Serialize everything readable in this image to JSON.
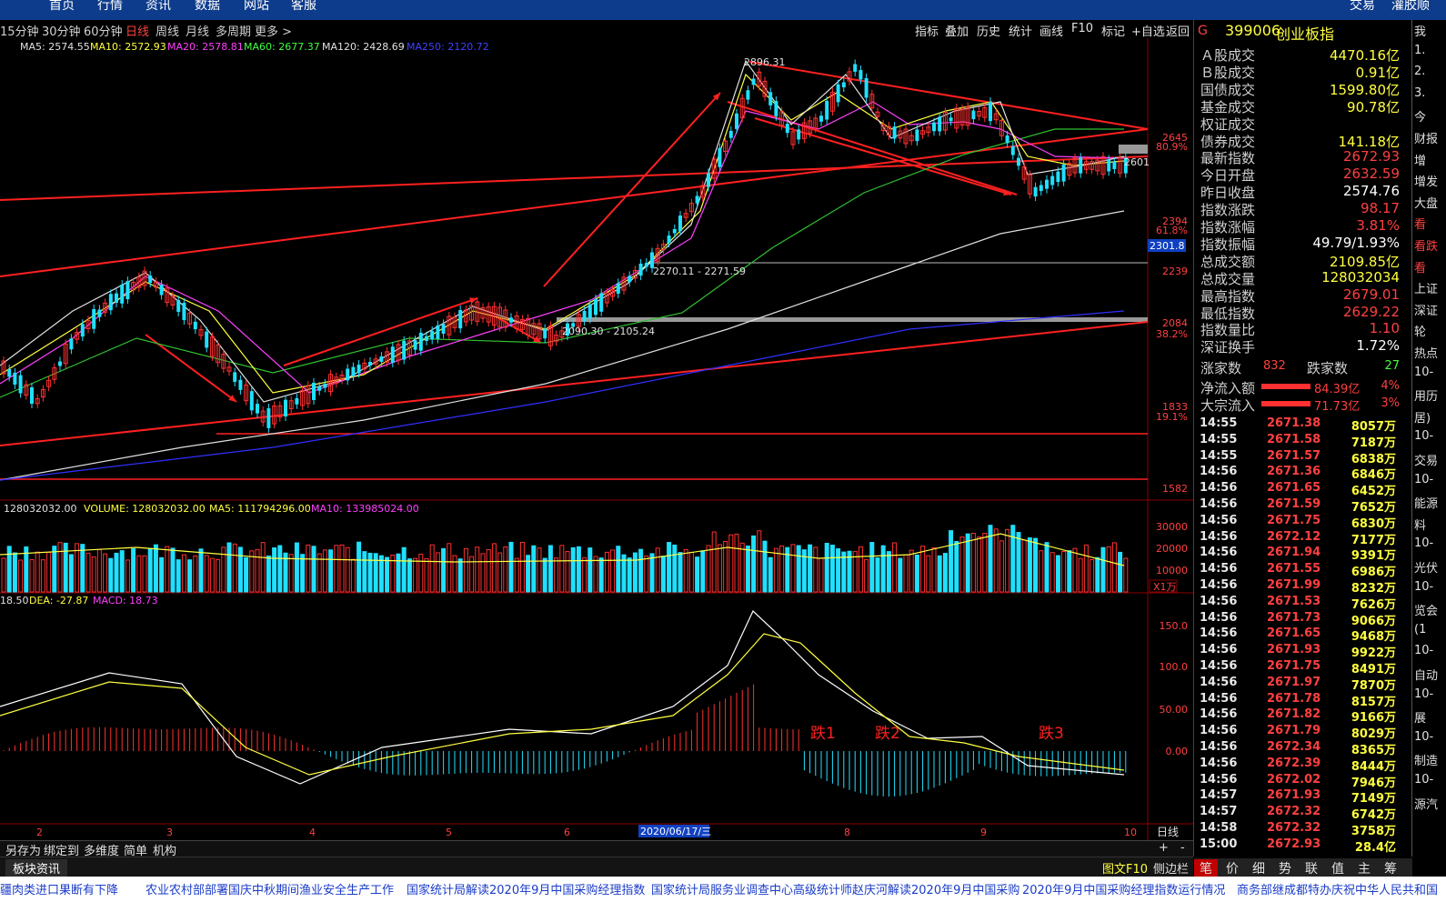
{
  "topbar": {
    "items": [
      "首页",
      "行情",
      "资讯",
      "数据",
      "网站",
      "客服"
    ],
    "right": [
      "交易",
      "灌胶顺"
    ]
  },
  "periods": {
    "items": [
      "15分钟",
      "30分钟",
      "60分钟",
      "日线",
      "周线",
      "月线",
      "多周期",
      "更多 >"
    ],
    "active": "日线"
  },
  "tools": {
    "items": [
      "指标",
      "叠加",
      "历史",
      "统计",
      "画线",
      "F10",
      "标记",
      "+自选",
      "返回"
    ]
  },
  "ma_legend": {
    "ma5": "MA5: 2574.55",
    "ma10": "MA10: 2572.93",
    "ma20": "MA20: 2578.81",
    "ma60": "MA60: 2677.37",
    "ma120": "MA120: 2428.69",
    "ma250": "MA250: 2120.72"
  },
  "chart_labels": {
    "peak": "2896.31",
    "range1": "2270.11 - 2271.59",
    "range2": "2090.30 - 2105.24",
    "current": "2601",
    "cursor_price": "2301.8"
  },
  "y_axis": {
    "price": [
      "2645",
      "2394",
      "2239",
      "2084",
      "1833",
      "1582"
    ],
    "pct": [
      "80.9%",
      "61.8%",
      "38.2%",
      "19.1%"
    ],
    "volume": [
      "30000",
      "20000",
      "10000"
    ],
    "vol_unit": "X1万",
    "macd": [
      "150.0",
      "100.0",
      "50.00",
      "0.00"
    ]
  },
  "volume_legend": {
    "vol": "128032032.00",
    "volume": "VOLUME: 128032032.00",
    "ma5": "MA5: 111794296.00",
    "ma10": "MA10: 133985024.00"
  },
  "macd_legend": {
    "diff": "18.50",
    "dea": "DEA: -27.87",
    "macd": "MACD: 18.73"
  },
  "annotations": [
    "跌1",
    "跌2",
    "跌3"
  ],
  "x_axis": {
    "labels": [
      "2",
      "3",
      "4",
      "5",
      "6",
      "8",
      "9",
      "10"
    ],
    "cursor_date": "2020/06/17/三",
    "period": "日线"
  },
  "bottom": {
    "buttons": [
      "另存为",
      "绑定到",
      "多维度",
      "简单",
      "机构"
    ],
    "plus": "+",
    "minus": "-"
  },
  "infobar": {
    "left": "板块资讯",
    "f10": "图文F10",
    "side": "侧边栏"
  },
  "panel": {
    "code": "399006",
    "name": "创业板指",
    "g": "G",
    "rows": [
      {
        "l": "Ａ股成交",
        "v": "4470.16亿",
        "c": "#ffff40"
      },
      {
        "l": "Ｂ股成交",
        "v": "0.91亿",
        "c": "#ffff40"
      },
      {
        "l": "国债成交",
        "v": "1599.80亿",
        "c": "#ffff40"
      },
      {
        "l": "基金成交",
        "v": "90.78亿",
        "c": "#ffff40"
      },
      {
        "l": "权证成交",
        "v": "",
        "c": "#ffff40"
      },
      {
        "l": "债券成交",
        "v": "141.18亿",
        "c": "#ffff40"
      },
      {
        "l": "最新指数",
        "v": "2672.93",
        "c": "#ff4040"
      },
      {
        "l": "今日开盘",
        "v": "2632.59",
        "c": "#ff4040"
      },
      {
        "l": "昨日收盘",
        "v": "2574.76",
        "c": "#ffffff"
      },
      {
        "l": "指数涨跌",
        "v": "98.17",
        "c": "#ff4040"
      },
      {
        "l": "指数涨幅",
        "v": "3.81%",
        "c": "#ff4040"
      },
      {
        "l": "指数振幅",
        "v": "49.79/1.93%",
        "c": "#ffffff"
      },
      {
        "l": "总成交额",
        "v": "2109.85亿",
        "c": "#ffff40"
      },
      {
        "l": "总成交量",
        "v": "128032034",
        "c": "#ffff40"
      },
      {
        "l": "最高指数",
        "v": "2679.01",
        "c": "#ff4040"
      },
      {
        "l": "最低指数",
        "v": "2629.22",
        "c": "#ff4040"
      },
      {
        "l": "指数量比",
        "v": "1.10",
        "c": "#ff4040"
      },
      {
        "l": "深证换手",
        "v": "1.72%",
        "c": "#ffffff"
      }
    ],
    "updown": {
      "up_label": "涨家数",
      "up": "832",
      "down_label": "跌家数",
      "down": "27"
    },
    "flows": [
      {
        "l": "净流入额",
        "v": "84.39亿",
        "p": "4%"
      },
      {
        "l": "大宗流入",
        "v": "71.73亿",
        "p": "3%"
      }
    ],
    "ticks": [
      [
        "14:55",
        "2671.38",
        "8057万"
      ],
      [
        "14:55",
        "2671.58",
        "7187万"
      ],
      [
        "14:55",
        "2671.57",
        "6838万"
      ],
      [
        "14:56",
        "2671.36",
        "6846万"
      ],
      [
        "14:56",
        "2671.65",
        "6452万"
      ],
      [
        "14:56",
        "2671.59",
        "7652万"
      ],
      [
        "14:56",
        "2671.75",
        "6830万"
      ],
      [
        "14:56",
        "2672.12",
        "7177万"
      ],
      [
        "14:56",
        "2671.94",
        "9391万"
      ],
      [
        "14:56",
        "2671.55",
        "6986万"
      ],
      [
        "14:56",
        "2671.99",
        "8232万"
      ],
      [
        "14:56",
        "2671.53",
        "7626万"
      ],
      [
        "14:56",
        "2671.73",
        "9066万"
      ],
      [
        "14:56",
        "2671.65",
        "9468万"
      ],
      [
        "14:56",
        "2671.93",
        "9922万"
      ],
      [
        "14:56",
        "2671.75",
        "8491万"
      ],
      [
        "14:56",
        "2671.97",
        "7870万"
      ],
      [
        "14:56",
        "2671.78",
        "8157万"
      ],
      [
        "14:56",
        "2671.82",
        "9166万"
      ],
      [
        "14:56",
        "2671.79",
        "8029万"
      ],
      [
        "14:56",
        "2672.34",
        "8365万"
      ],
      [
        "14:56",
        "2672.39",
        "8444万"
      ],
      [
        "14:56",
        "2672.02",
        "7946万"
      ],
      [
        "14:57",
        "2671.93",
        "7149万"
      ],
      [
        "14:57",
        "2672.32",
        "6742万"
      ],
      [
        "14:58",
        "2672.32",
        "3758万"
      ],
      [
        "15:00",
        "2672.93",
        "28.4亿"
      ]
    ],
    "tabs": [
      "笔",
      "价",
      "细",
      "势",
      "联",
      "值",
      "主",
      "筹"
    ]
  },
  "farright": [
    "我",
    "1.",
    "2.",
    "3.",
    "今",
    "财报",
    "增",
    "增发",
    "大盘",
    "看",
    "看跌",
    "看",
    "上证",
    "深证",
    "轮",
    "热点",
    "10-",
    "用历",
    "居)",
    "10-",
    "交易",
    "10-",
    "能源",
    "料",
    "10-",
    "光伏",
    "10-",
    "览会",
    "(1",
    "10-",
    "自动",
    "10-",
    "展",
    "10-",
    "制造",
    "10-",
    "源汽"
  ],
  "news": [
    "疆肉类进口果断有下降",
    "农业农村部部署国庆中秋期间渔业安全生产工作",
    "国家统计局解读2020年9月中国采购经理指数",
    "国家统计局服务业调查中心高级统计师赵庆河解读2020年9月中国采购",
    "2020年9月中国采购经理指数运行情况",
    "商务部继成都特办庆祝中华人民共和国"
  ]
}
